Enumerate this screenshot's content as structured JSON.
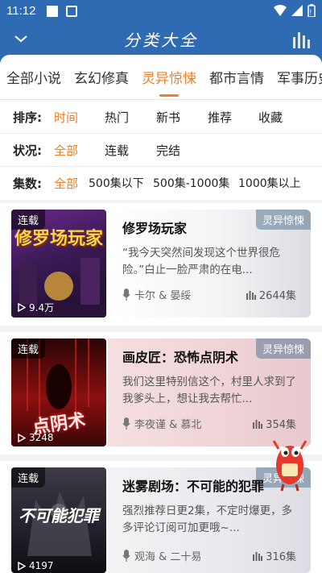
{
  "status": {
    "time": "11:12"
  },
  "header": {
    "title": "分类大全"
  },
  "tabs": [
    {
      "label": "全部小说",
      "active": false
    },
    {
      "label": "玄幻修真",
      "active": false
    },
    {
      "label": "灵异惊悚",
      "active": true
    },
    {
      "label": "都市言情",
      "active": false
    },
    {
      "label": "军事历史",
      "active": false
    }
  ],
  "filters": {
    "sort": {
      "label": "排序:",
      "options": [
        "时间",
        "热门",
        "新书",
        "推荐",
        "收藏"
      ],
      "selected": 0
    },
    "state": {
      "label": "状况:",
      "options": [
        "全部",
        "连载",
        "完结"
      ],
      "selected": 0
    },
    "episodes": {
      "label": "集数:",
      "options": [
        "全部",
        "500集以下",
        "500集-1000集",
        "1000集以上"
      ],
      "selected": 0
    }
  },
  "books": [
    {
      "badge": "连载",
      "plays": "9.4万",
      "category": "灵异惊悚",
      "title": "修罗场玩家",
      "desc": "“我今天突然间发现这个世界很危险。”白止一脸严肃的在电...",
      "author": "卡尔 & 晏绥",
      "episodes": "2644集",
      "cover_text": "修罗场玩家"
    },
    {
      "badge": "连载",
      "plays": "3248",
      "category": "灵异惊悚",
      "title": "画皮匠：恐怖点阴术",
      "desc": "我们这里特别信这个，村里人求到了我爹头上，想让我去帮忙...",
      "author": "李夜谨 & 慕北",
      "episodes": "354集",
      "cover_text": "点阴术"
    },
    {
      "badge": "连载",
      "plays": "4197",
      "category": "灵异惊悚",
      "title": "迷雾剧场：不可能的犯罪",
      "desc": "强烈推荐日更2集，不定时爆更，多多评论订阅可加更哦~...",
      "author": "观海 & 二十易",
      "episodes": "316集",
      "cover_text": "不可能犯罪"
    }
  ],
  "colors": {
    "brand": "#2e6bb3",
    "accent": "#f07f24"
  }
}
